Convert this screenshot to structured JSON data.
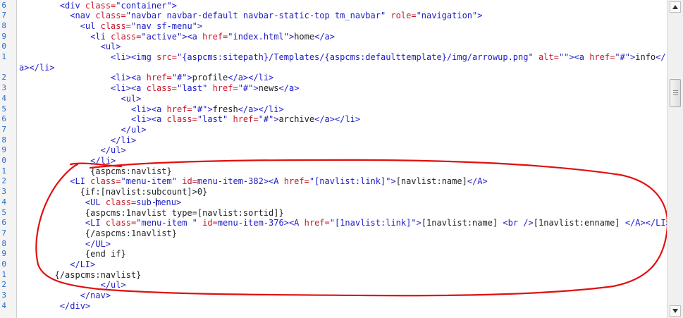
{
  "editor": {
    "lines": [
      {
        "n": "6",
        "parts": [
          [
            "t",
            "        "
          ],
          [
            "g",
            "<div "
          ],
          [
            "a",
            "class="
          ],
          [
            "s",
            "\"container\""
          ],
          [
            "g",
            ">"
          ]
        ]
      },
      {
        "n": "7",
        "parts": [
          [
            "t",
            "          "
          ],
          [
            "g",
            "<nav "
          ],
          [
            "a",
            "class="
          ],
          [
            "s",
            "\"navbar navbar-default navbar-static-top tm_navbar\""
          ],
          [
            "a",
            " role="
          ],
          [
            "s",
            "\"navigation\""
          ],
          [
            "g",
            ">"
          ]
        ]
      },
      {
        "n": "8",
        "parts": [
          [
            "t",
            "            "
          ],
          [
            "g",
            "<ul "
          ],
          [
            "a",
            "class="
          ],
          [
            "s",
            "\"nav sf-menu\""
          ],
          [
            "g",
            ">"
          ]
        ]
      },
      {
        "n": "9",
        "parts": [
          [
            "t",
            "              "
          ],
          [
            "g",
            "<li "
          ],
          [
            "a",
            "class="
          ],
          [
            "s",
            "\"active\""
          ],
          [
            "g",
            "><a "
          ],
          [
            "a",
            "href="
          ],
          [
            "s",
            "\"index.html\""
          ],
          [
            "g",
            ">"
          ],
          [
            "t",
            "home"
          ],
          [
            "g",
            "</a>"
          ]
        ]
      },
      {
        "n": "0",
        "parts": [
          [
            "t",
            "                "
          ],
          [
            "g",
            "<ul>"
          ]
        ]
      },
      {
        "n": "1",
        "parts": [
          [
            "t",
            "                  "
          ],
          [
            "g",
            "<li><img "
          ],
          [
            "a",
            "src="
          ],
          [
            "s",
            "\"{aspcms:sitepath}/Templates/{aspcms:defaulttemplate}/img/arrowup.png\""
          ],
          [
            "a",
            " alt="
          ],
          [
            "s",
            "\"\""
          ],
          [
            "g",
            "><a "
          ],
          [
            "a",
            "href="
          ],
          [
            "s",
            "\"#\""
          ],
          [
            "g",
            ">"
          ],
          [
            "t",
            "info"
          ],
          [
            "g",
            "</"
          ]
        ]
      },
      {
        "n": "",
        "parts": [
          [
            "g",
            "a></li>"
          ]
        ]
      },
      {
        "n": "2",
        "parts": [
          [
            "t",
            "                  "
          ],
          [
            "g",
            "<li><a "
          ],
          [
            "a",
            "href="
          ],
          [
            "s",
            "\"#\""
          ],
          [
            "g",
            ">"
          ],
          [
            "t",
            "profile"
          ],
          [
            "g",
            "</a></li>"
          ]
        ]
      },
      {
        "n": "3",
        "parts": [
          [
            "t",
            "                  "
          ],
          [
            "g",
            "<li><a "
          ],
          [
            "a",
            "class="
          ],
          [
            "s",
            "\"last\""
          ],
          [
            "a",
            " href="
          ],
          [
            "s",
            "\"#\""
          ],
          [
            "g",
            ">"
          ],
          [
            "t",
            "news"
          ],
          [
            "g",
            "</a>"
          ]
        ]
      },
      {
        "n": "4",
        "parts": [
          [
            "t",
            "                    "
          ],
          [
            "g",
            "<ul>"
          ]
        ]
      },
      {
        "n": "5",
        "parts": [
          [
            "t",
            "                      "
          ],
          [
            "g",
            "<li><a "
          ],
          [
            "a",
            "href="
          ],
          [
            "s",
            "\"#\""
          ],
          [
            "g",
            ">"
          ],
          [
            "t",
            "fresh"
          ],
          [
            "g",
            "</a></li>"
          ]
        ]
      },
      {
        "n": "6",
        "parts": [
          [
            "t",
            "                      "
          ],
          [
            "g",
            "<li><a "
          ],
          [
            "a",
            "class="
          ],
          [
            "s",
            "\"last\""
          ],
          [
            "a",
            " href="
          ],
          [
            "s",
            "\"#\""
          ],
          [
            "g",
            ">"
          ],
          [
            "t",
            "archive"
          ],
          [
            "g",
            "</a></li>"
          ]
        ]
      },
      {
        "n": "7",
        "parts": [
          [
            "t",
            "                    "
          ],
          [
            "g",
            "</ul>"
          ]
        ]
      },
      {
        "n": "8",
        "parts": [
          [
            "t",
            "                  "
          ],
          [
            "g",
            "</li>"
          ]
        ]
      },
      {
        "n": "9",
        "parts": [
          [
            "t",
            "                "
          ],
          [
            "g",
            "</ul>"
          ]
        ]
      },
      {
        "n": "0",
        "parts": [
          [
            "t",
            "              "
          ],
          [
            "g",
            "</li>"
          ]
        ]
      },
      {
        "n": "1",
        "parts": [
          [
            "t",
            "              {aspcms:navlist}"
          ]
        ]
      },
      {
        "n": "2",
        "parts": [
          [
            "t",
            "          "
          ],
          [
            "g",
            "<LI "
          ],
          [
            "a",
            "class="
          ],
          [
            "s",
            "\"menu-item\""
          ],
          [
            "a",
            " id="
          ],
          [
            "s",
            "menu-item-382"
          ],
          [
            "g",
            "><A "
          ],
          [
            "a",
            "href="
          ],
          [
            "s",
            "\"[navlist:link]\""
          ],
          [
            "g",
            ">"
          ],
          [
            "t",
            "[navlist:name]"
          ],
          [
            "g",
            "</A>"
          ]
        ]
      },
      {
        "n": "3",
        "parts": [
          [
            "t",
            "            {if:[navlist:subcount]>0}"
          ]
        ]
      },
      {
        "n": "4",
        "parts": [
          [
            "t",
            "             "
          ],
          [
            "g",
            "<UL "
          ],
          [
            "a",
            "class="
          ],
          [
            "s",
            "sub-"
          ],
          [
            "c",
            ""
          ],
          [
            "s",
            "menu"
          ],
          [
            "g",
            ">"
          ]
        ]
      },
      {
        "n": "5",
        "parts": [
          [
            "t",
            "             {aspcms:1navlist type=[navlist:sortid]}"
          ]
        ]
      },
      {
        "n": "6",
        "parts": [
          [
            "t",
            "             "
          ],
          [
            "g",
            "<LI "
          ],
          [
            "a",
            "class="
          ],
          [
            "s",
            "\"menu-item \""
          ],
          [
            "a",
            " id="
          ],
          [
            "s",
            "menu-item-376"
          ],
          [
            "g",
            "><A "
          ],
          [
            "a",
            "href="
          ],
          [
            "s",
            "\"[1navlist:link]\""
          ],
          [
            "g",
            ">"
          ],
          [
            "t",
            "[1navlist:name] "
          ],
          [
            "g",
            "<br />"
          ],
          [
            "t",
            "[1navlist:enname] "
          ],
          [
            "g",
            "</A></LI>"
          ]
        ]
      },
      {
        "n": "7",
        "parts": [
          [
            "t",
            "             {/aspcms:1navlist}"
          ]
        ]
      },
      {
        "n": "8",
        "parts": [
          [
            "t",
            "             "
          ],
          [
            "g",
            "</UL>"
          ]
        ]
      },
      {
        "n": "9",
        "parts": [
          [
            "t",
            "             {end if}"
          ]
        ]
      },
      {
        "n": "0",
        "parts": [
          [
            "t",
            "          "
          ],
          [
            "g",
            "</LI>"
          ]
        ]
      },
      {
        "n": "1",
        "parts": [
          [
            "t",
            "       {/aspcms:navlist}"
          ]
        ]
      },
      {
        "n": "2",
        "parts": [
          [
            "t",
            "                "
          ],
          [
            "g",
            "</ul>"
          ]
        ]
      },
      {
        "n": "3",
        "parts": [
          [
            "t",
            "            "
          ],
          [
            "g",
            "</nav>"
          ]
        ]
      },
      {
        "n": "4",
        "parts": [
          [
            "t",
            "        "
          ],
          [
            "g",
            "</div>"
          ]
        ]
      }
    ]
  },
  "colors": {
    "tag": "#1c1cc9",
    "attribute": "#c8182a",
    "string": "#1c1cc9",
    "text": "#222222",
    "line_number": "#2b6cc6",
    "annotation": "#e01010"
  },
  "scrollbar": {
    "up_icon": "arrow-up-icon",
    "down_icon": "arrow-down-icon",
    "position": 0.27
  }
}
